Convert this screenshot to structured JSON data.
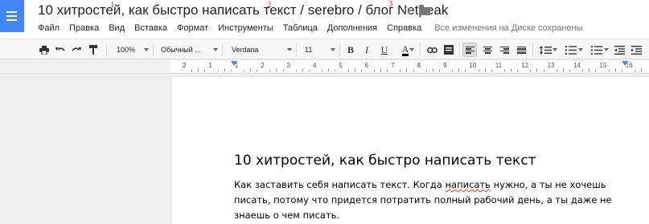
{
  "doc": {
    "title": "10 хитростей, как быстро написать текст / serebro / блог Netpeak",
    "annotations": [
      "1",
      "2",
      "3"
    ]
  },
  "menu": {
    "items": [
      "Файл",
      "Правка",
      "Вид",
      "Вставка",
      "Формат",
      "Инструменты",
      "Таблица",
      "Дополнения",
      "Справка"
    ],
    "save_status": "Все изменения на Диске сохранены"
  },
  "toolbar": {
    "zoom": "100%",
    "style": "Обычный ...",
    "font": "Verdana",
    "font_size": "11",
    "bold": "B",
    "italic": "I",
    "underline": "U",
    "text_color": "A"
  },
  "ruler": {
    "numbers": [
      "2",
      "1",
      "1",
      "2",
      "3",
      "4",
      "5",
      "6",
      "7",
      "8",
      "9",
      "10",
      "11",
      "12",
      "13",
      "14",
      "15",
      "16"
    ]
  },
  "document": {
    "heading": "10 хитростей, как быстро написать текст",
    "body_before": "Как заставить себя написать текст. Когда ",
    "body_spell": "написать",
    "body_after": " нужно, а ты не хочешь писать, потому что придется потратить полный рабочий день, а ты даже не знаешь о чем писать."
  },
  "colors": {
    "app_icon": "#4285f4",
    "annotation": "#dd2222",
    "spellcheck": "#e53935",
    "indent_marker": "#4a86e8"
  }
}
